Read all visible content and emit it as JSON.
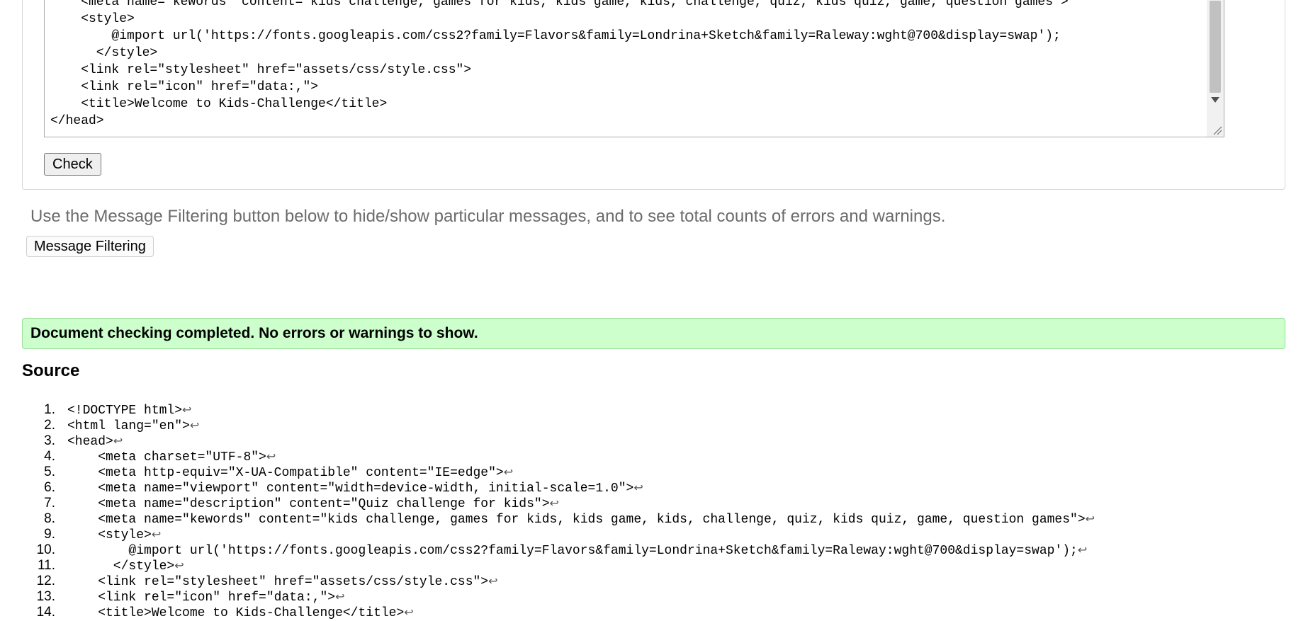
{
  "textarea": {
    "lines": [
      "    <meta name=\"kewords\" content=\"kids challenge, games for kids, kids game, kids, challenge, quiz, kids quiz, game, question games\">",
      "    <style>",
      "        @import url('https://fonts.googleapis.com/css2?family=Flavors&family=Londrina+Sketch&family=Raleway:wght@700&display=swap');",
      "      </style>",
      "    <link rel=\"stylesheet\" href=\"assets/css/style.css\">",
      "    <link rel=\"icon\" href=\"data:,\">",
      "    <title>Welcome to Kids-Challenge</title>",
      "</head>"
    ]
  },
  "check_button_label": "Check",
  "filter_hint": "Use the Message Filtering button below to hide/show particular messages, and to see total counts of errors and warnings.",
  "message_filtering_label": "Message Filtering",
  "success_message": "Document checking completed. No errors or warnings to show.",
  "source_heading": "Source",
  "source_lines": [
    {
      "num": "1.",
      "code": "<!DOCTYPE html>"
    },
    {
      "num": "2.",
      "code": "<html lang=\"en\">"
    },
    {
      "num": "3.",
      "code": "<head>"
    },
    {
      "num": "4.",
      "code": "    <meta charset=\"UTF-8\">"
    },
    {
      "num": "5.",
      "code": "    <meta http-equiv=\"X-UA-Compatible\" content=\"IE=edge\">"
    },
    {
      "num": "6.",
      "code": "    <meta name=\"viewport\" content=\"width=device-width, initial-scale=1.0\">"
    },
    {
      "num": "7.",
      "code": "    <meta name=\"description\" content=\"Quiz challenge for kids\">"
    },
    {
      "num": "8.",
      "code": "    <meta name=\"kewords\" content=\"kids challenge, games for kids, kids game, kids, challenge, quiz, kids quiz, game, question games\">"
    },
    {
      "num": "9.",
      "code": "    <style>"
    },
    {
      "num": "10.",
      "code": "        @import url('https://fonts.googleapis.com/css2?family=Flavors&family=Londrina+Sketch&family=Raleway:wght@700&display=swap');"
    },
    {
      "num": "11.",
      "code": "      </style>"
    },
    {
      "num": "12.",
      "code": "    <link rel=\"stylesheet\" href=\"assets/css/style.css\">"
    },
    {
      "num": "13.",
      "code": "    <link rel=\"icon\" href=\"data:,\">"
    },
    {
      "num": "14.",
      "code": "    <title>Welcome to Kids-Challenge</title>"
    }
  ],
  "return_glyph": "↩"
}
